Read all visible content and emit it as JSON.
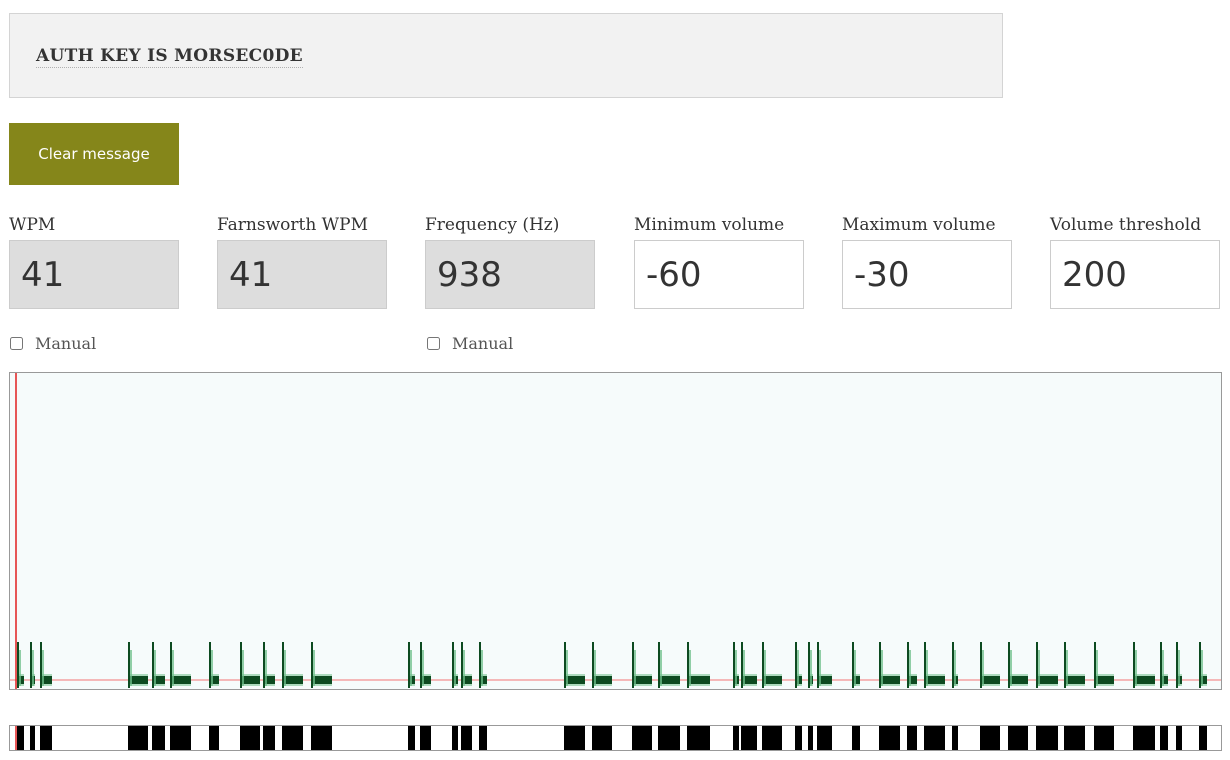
{
  "message": {
    "text": "AUTH KEY IS MORSEC0DE"
  },
  "clear_button": {
    "label": "Clear message"
  },
  "fields": {
    "wpm": {
      "label": "WPM",
      "value": "41"
    },
    "farnsworth_wpm": {
      "label": "Farnsworth WPM",
      "value": "41"
    },
    "frequency": {
      "label": "Frequency (Hz)",
      "value": "938"
    },
    "min_volume": {
      "label": "Minimum volume",
      "value": "-60"
    },
    "max_volume": {
      "label": "Maximum volume",
      "value": "-30"
    },
    "volume_threshold": {
      "label": "Volume threshold",
      "value": "200"
    }
  },
  "manual_wpm": {
    "label": "Manual",
    "checked": false
  },
  "manual_frequency": {
    "label": "Manual",
    "checked": false
  },
  "colors": {
    "button_bg": "#85861a",
    "signal_dark": "#0d4a20",
    "signal_light": "#6fbf8a",
    "threshold_line": "#f4b8b8",
    "cursor_line": "#e02020"
  }
}
